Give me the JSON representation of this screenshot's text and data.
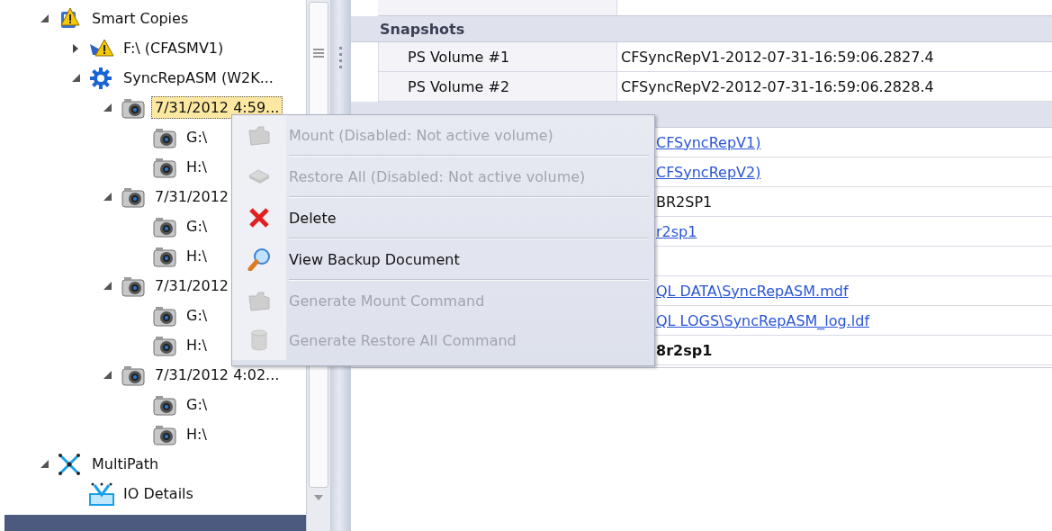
{
  "tree": [
    {
      "label": "Smart Copies",
      "kind": "shield",
      "expanded": true,
      "selected": false,
      "children": [
        {
          "label": "F:\\ (CFASMV1)",
          "kind": "warning",
          "expanded": false,
          "selected": false
        },
        {
          "label": "SyncRepASM (W2K...",
          "kind": "gear",
          "expanded": true,
          "selected": false,
          "children": [
            {
              "label": "7/31/2012 4:59...",
              "kind": "camera",
              "expanded": true,
              "selected": true,
              "children": [
                {
                  "label": "G:\\",
                  "kind": "camera",
                  "selected": false
                },
                {
                  "label": "H:\\",
                  "kind": "camera",
                  "selected": false
                }
              ]
            },
            {
              "label": "7/31/2012",
              "kind": "camera",
              "expanded": true,
              "selected": false,
              "children": [
                {
                  "label": "G:\\",
                  "kind": "camera",
                  "selected": false
                },
                {
                  "label": "H:\\",
                  "kind": "camera",
                  "selected": false
                }
              ]
            },
            {
              "label": "7/31/2012",
              "kind": "camera",
              "expanded": true,
              "selected": false,
              "children": [
                {
                  "label": "G:\\",
                  "kind": "camera",
                  "selected": false
                },
                {
                  "label": "H:\\",
                  "kind": "camera",
                  "selected": false
                }
              ]
            },
            {
              "label": "7/31/2012 4:02...",
              "kind": "camera",
              "expanded": true,
              "selected": false,
              "children": [
                {
                  "label": "G:\\",
                  "kind": "camera",
                  "selected": false
                },
                {
                  "label": "H:\\",
                  "kind": "camera",
                  "selected": false
                }
              ]
            }
          ]
        }
      ]
    },
    {
      "label": "MultiPath",
      "kind": "network",
      "expanded": true,
      "selected": false,
      "children": [
        {
          "label": "IO Details",
          "kind": "io",
          "selected": false
        }
      ]
    }
  ],
  "properties": [
    {
      "label": "Snapshots",
      "kind": "open",
      "rows": [
        {
          "label": "PS Volume #1",
          "value": "CFSyncRepV1-2012-07-31-16:59:06.2827.4",
          "kind": "text"
        },
        {
          "label": "PS Volume #2",
          "value": "CFSyncRepV2-2012-07-31-16:59:06.2828.4",
          "kind": "text"
        }
      ]
    },
    {
      "kind": "covered",
      "rows": [
        {
          "value": "CFSyncRepV1)",
          "kind": "link"
        },
        {
          "value": "CFSyncRepV2)",
          "kind": "link"
        },
        {
          "value": "BR2SP1",
          "kind": "text"
        },
        {
          "value": "r2sp1",
          "kind": "link"
        },
        {},
        {
          "value": "QL DATA\\SyncRepASM.mdf",
          "kind": "link"
        },
        {
          "value": "QL LOGS\\SyncRepASM_log.ldf",
          "kind": "link"
        },
        {
          "value": "8r2sp1",
          "kind": "bold"
        }
      ]
    }
  ],
  "context_menu": [
    {
      "label": "Mount (Disabled: Not active volume)",
      "kind": "folder",
      "disabled": true
    },
    {
      "label": "Restore All (Disabled: Not active volume)",
      "kind": "drive",
      "disabled": true
    },
    {
      "label": "Delete",
      "kind": "delete",
      "disabled": false
    },
    {
      "label": "View Backup Document",
      "kind": "search",
      "disabled": false
    },
    {
      "label": "Generate Mount Command",
      "kind": "folder",
      "disabled": true
    },
    {
      "label": "Generate Restore All Command",
      "kind": "database",
      "disabled": true
    }
  ]
}
